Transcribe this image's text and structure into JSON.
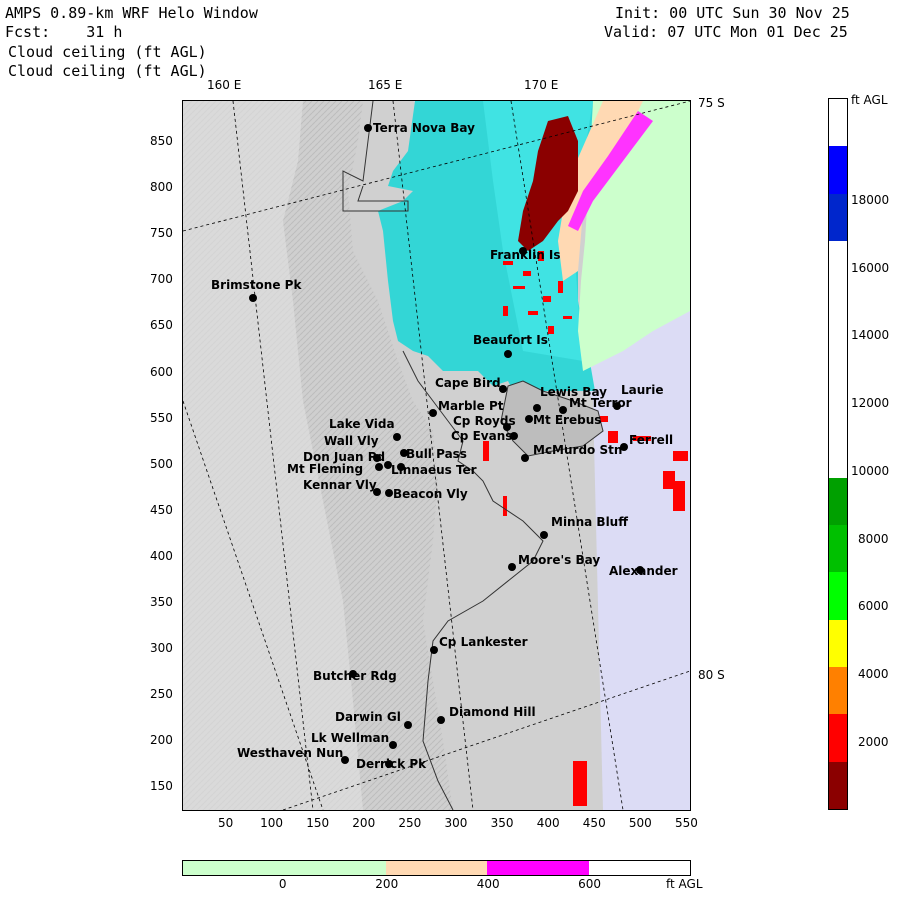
{
  "header": {
    "title": "AMPS 0.89-km WRF Helo Window",
    "fcst": "Fcst:    31 h",
    "field1": "Cloud ceiling (ft AGL)",
    "field2": "Cloud ceiling (ft AGL)",
    "init": "Init: 00 UTC Sun 30 Nov 25",
    "valid": "Valid: 07 UTC Mon 01 Dec 25"
  },
  "graticule": {
    "lon_labels": [
      "160 E",
      "165 E",
      "170 E"
    ],
    "lat_labels": [
      "75 S",
      "80 S"
    ]
  },
  "y_ticks": [
    "850",
    "800",
    "750",
    "700",
    "650",
    "600",
    "550",
    "500",
    "450",
    "400",
    "350",
    "300",
    "250",
    "200",
    "150"
  ],
  "x_ticks": [
    "50",
    "100",
    "150",
    "200",
    "250",
    "300",
    "350",
    "400",
    "450",
    "500",
    "550"
  ],
  "places": [
    {
      "name": "Terra Nova Bay"
    },
    {
      "name": "Brimstone Pk"
    },
    {
      "name": "Franklin Is"
    },
    {
      "name": "Beaufort Is"
    },
    {
      "name": "Cape Bird"
    },
    {
      "name": "Lewis Bay"
    },
    {
      "name": "Laurie"
    },
    {
      "name": "Mt Terror"
    },
    {
      "name": "Marble Pt"
    },
    {
      "name": "Cp Royds"
    },
    {
      "name": "Mt Erebus"
    },
    {
      "name": "Lake Vida"
    },
    {
      "name": "Cp Evans"
    },
    {
      "name": "Ferrell"
    },
    {
      "name": "Wall Vly"
    },
    {
      "name": "Bull Pass"
    },
    {
      "name": "McMurdo Stn"
    },
    {
      "name": "Don Juan Pd"
    },
    {
      "name": "Linnaeus Ter"
    },
    {
      "name": "Mt Fleming"
    },
    {
      "name": "Kennar Vly"
    },
    {
      "name": "Beacon Vly"
    },
    {
      "name": "Minna Bluff"
    },
    {
      "name": "Moore's Bay"
    },
    {
      "name": "Alexander"
    },
    {
      "name": "Cp Lankester"
    },
    {
      "name": "Butcher Rdg"
    },
    {
      "name": "Darwin Gl"
    },
    {
      "name": "Diamond Hill"
    },
    {
      "name": "Lk Wellman"
    },
    {
      "name": "Westhaven Nun"
    },
    {
      "name": "Derrick Pk"
    }
  ],
  "colorbar": {
    "unit": "ft AGL",
    "ticks": [
      "18000",
      "16000",
      "14000",
      "12000",
      "10000",
      "8000",
      "6000",
      "4000",
      "2000"
    ],
    "colors": [
      "#ffffff",
      "#0000ff",
      "#0026cc",
      "#ffffff",
      "#ffffff",
      "#ffffff",
      "#ffffff",
      "#ffffff",
      "#00a000",
      "#00c000",
      "#00ff00",
      "#ffff00",
      "#ff8000",
      "#ff0000",
      "#8b0000"
    ]
  },
  "hbar": {
    "unit": "ft AGL",
    "ticks": [
      "0",
      "200",
      "400",
      "600"
    ],
    "colors": [
      "#ccffcc",
      "#ccffcc",
      "#ffd9b3",
      "#ff00ff",
      "#ffffff"
    ]
  }
}
